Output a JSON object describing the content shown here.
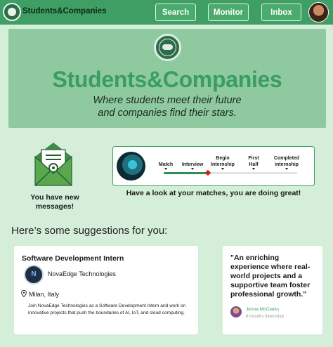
{
  "nav": {
    "brand": "Students&Companies",
    "buttons": {
      "search": "Search",
      "monitor": "Monitor",
      "inbox": "Inbox"
    }
  },
  "hero": {
    "title": "Students&Companies",
    "subtitle_line1": "Where students meet their future",
    "subtitle_line2": "and companies find their stars."
  },
  "messages": {
    "line1": "You have new",
    "line2": "messages!",
    "icon": "mail-icon"
  },
  "progress": {
    "stages": [
      {
        "line1": "Match",
        "line2": ""
      },
      {
        "line1": "Interview",
        "line2": ""
      },
      {
        "line1": "Begin",
        "line2": "Internship"
      },
      {
        "line1": "First",
        "line2": "Half"
      },
      {
        "line1": "Completed",
        "line2": "internship"
      }
    ],
    "current_stage_index": 1,
    "completed_fraction": 0.33,
    "caption": "Have a look at your matches, you are doing great!",
    "colors": {
      "fill": "#2f8f55",
      "marker": "#d11f1f",
      "track": "#e3e3e3"
    }
  },
  "suggestions": {
    "heading": "Here’s some suggestions for you:",
    "job": {
      "title": "Software Development Intern",
      "company": "NovaEdge Technologies",
      "logo_letter": "N",
      "location": "Milan, Italy",
      "description": "Join NovaEdge Technologies as a Software Development Intern and work on innovative projects that push the boundaries of AI, IoT, and cloud computing."
    },
    "testimonial": {
      "quote": "\"An enriching experience where real-world projects and a supportive team foster professional growth.\"",
      "author": "Jenna McClarks",
      "meta": "6 months internship"
    }
  },
  "colors": {
    "background": "#d4eed9",
    "nav": "#3e9e63",
    "hero": "#8ec9a0",
    "accent": "#3a9d62"
  }
}
